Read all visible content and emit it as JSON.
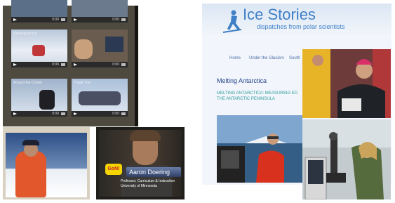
{
  "videos": [
    {
      "caption": ""
    },
    {
      "caption": ""
    },
    {
      "caption": "Running on ice"
    },
    {
      "caption": ""
    },
    {
      "caption": "Around the Corner"
    },
    {
      "caption": "Thank You!"
    }
  ],
  "interview": {
    "name": "Aaron Doering",
    "subtitle_line1": "Professor, Curriculum & Instruction",
    "subtitle_line2": "University of Minnesota",
    "badge": "GoN!"
  },
  "site": {
    "title": "Ice Stories",
    "tagline": "dispatches from polar scientists",
    "nav": [
      "Home",
      "Under the Glaciers",
      "South"
    ],
    "heading": "Melting Antarctica",
    "subheading_line1": "MELTING ANTARCTICA: MEASURING ED",
    "subheading_line2": "THE ANTARCTIC PENINSULA"
  },
  "colors": {
    "grid_bg": "#4e4a3f",
    "site_blue": "#3f7fc6",
    "heading_navy": "#27468a",
    "teal": "#2e9e9e"
  }
}
